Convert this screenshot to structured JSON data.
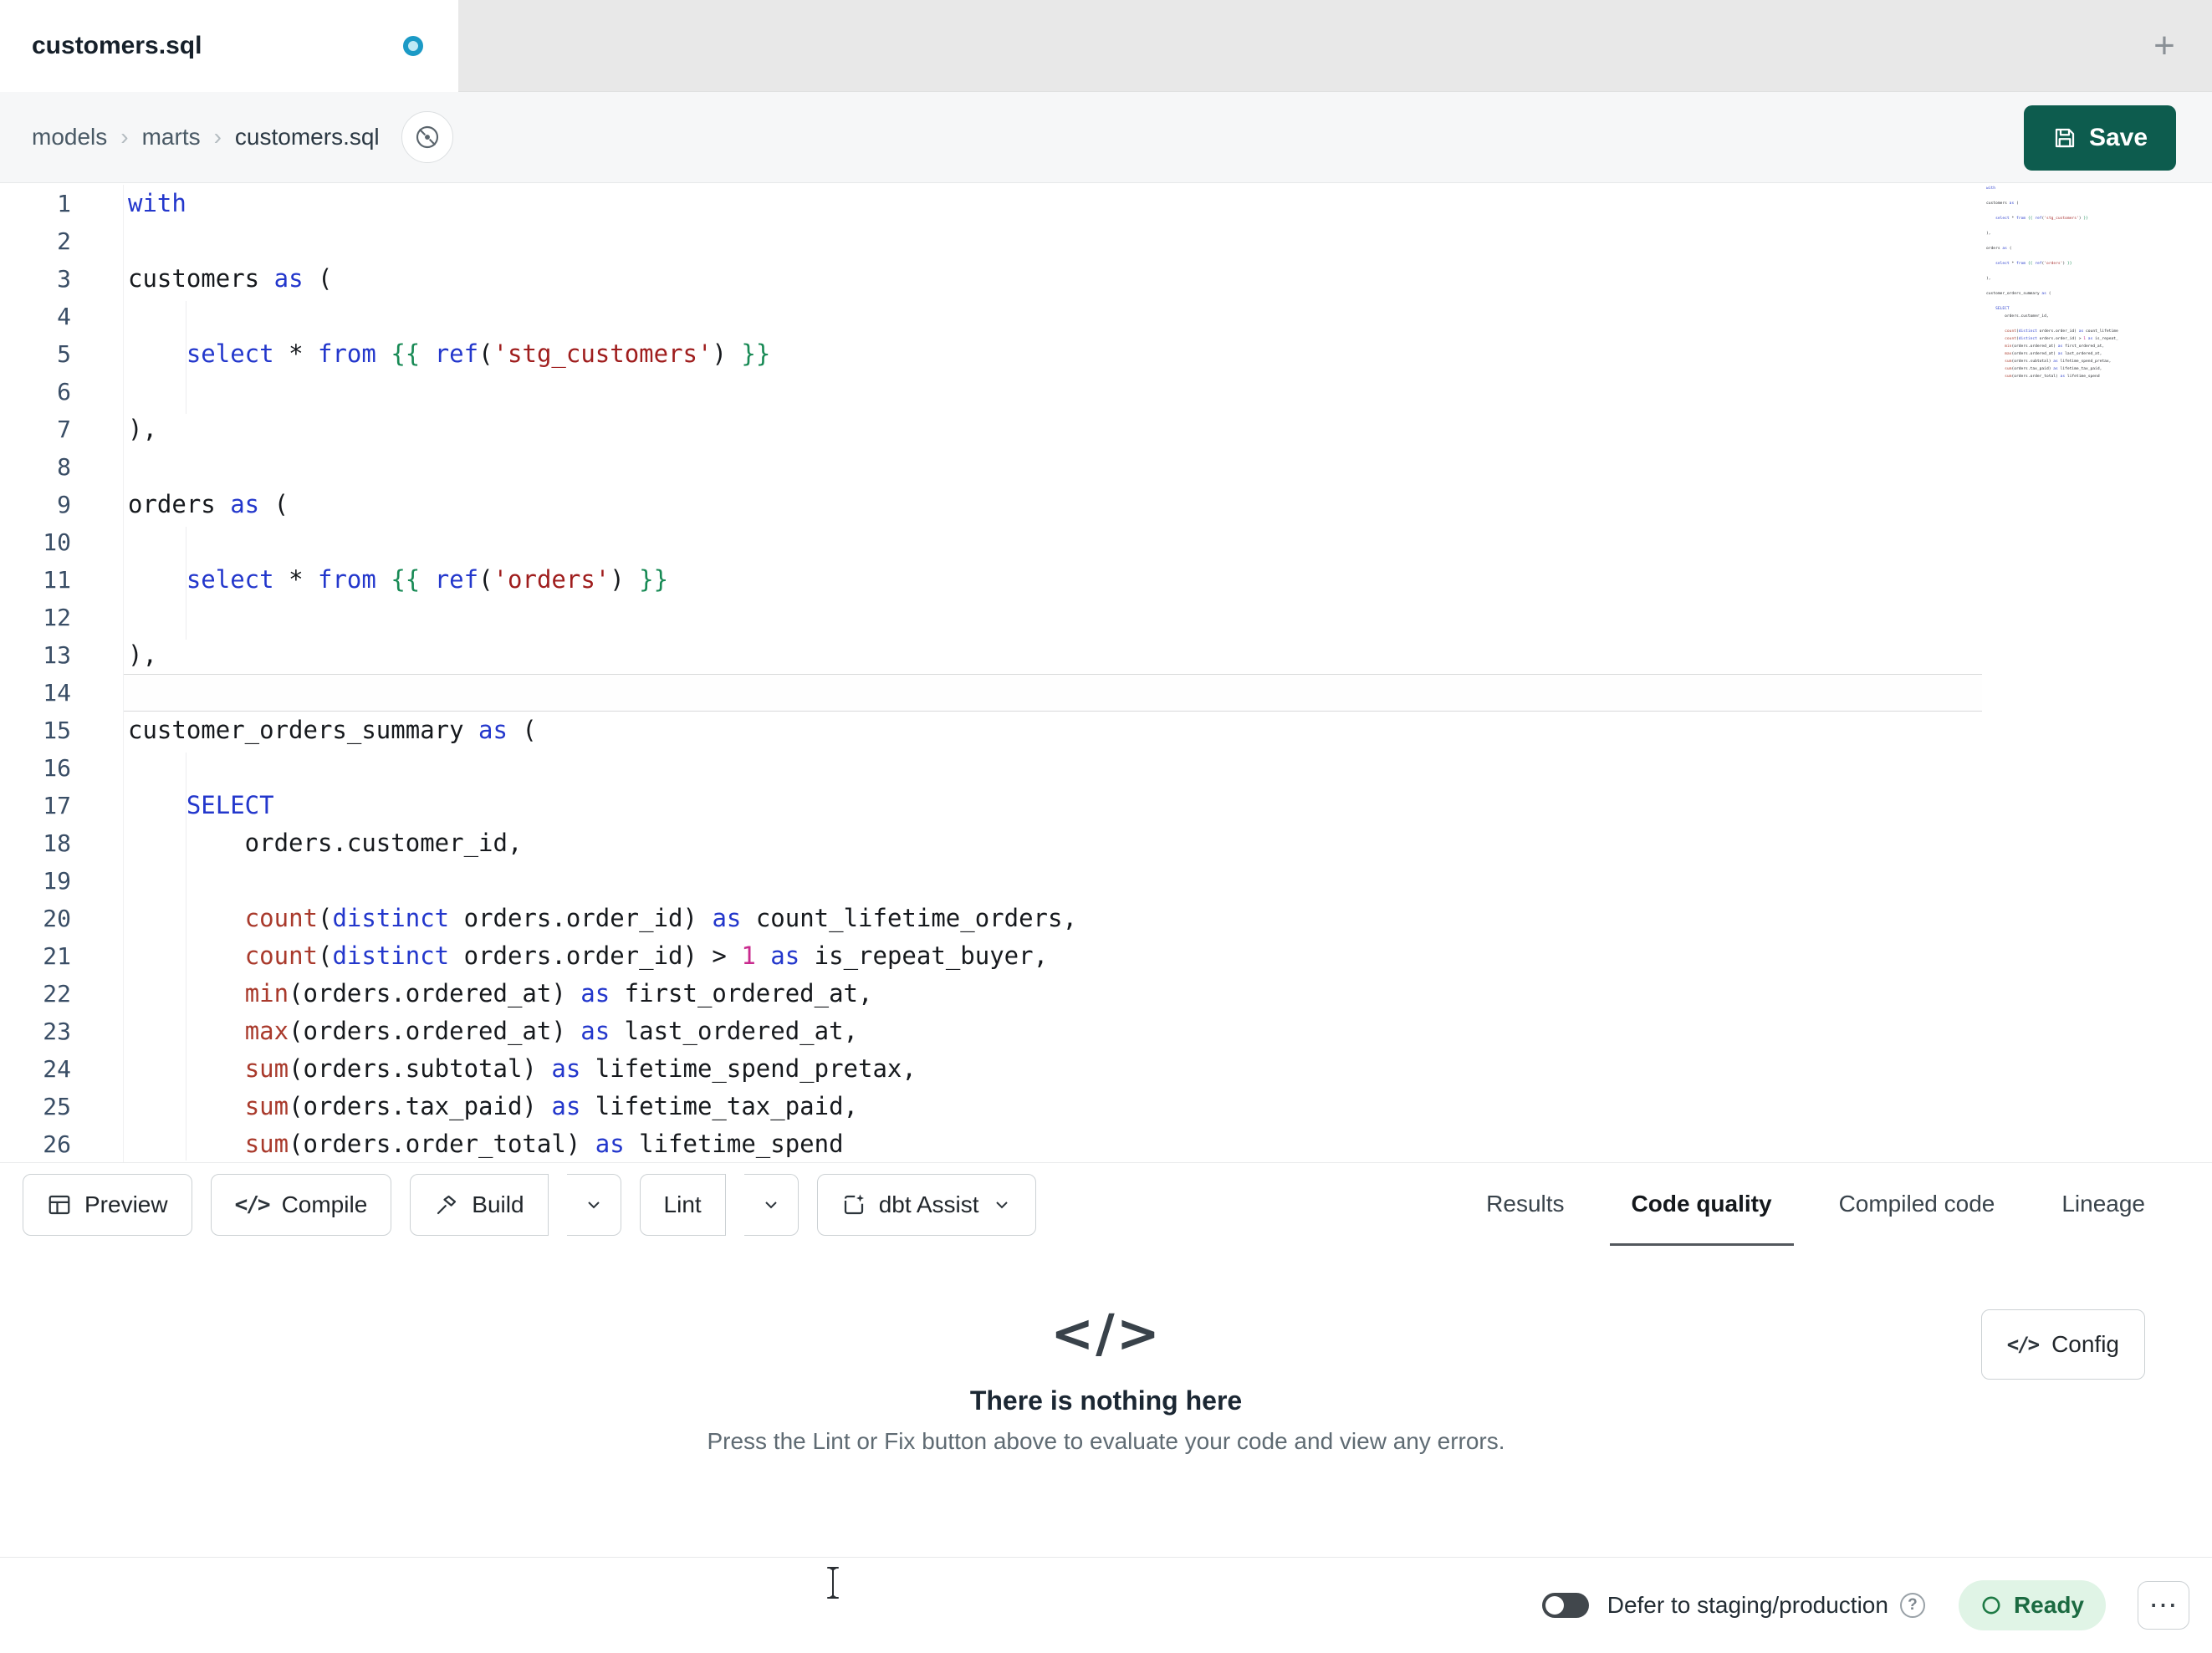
{
  "colors": {
    "save_button": "#0d5c4e",
    "keyword": "#2337cc",
    "function": "#a93a2c",
    "string": "#9f1d1d",
    "number": "#c92a8e",
    "jinja": "#188a55",
    "unsaved_dot": "#1b9ac6",
    "ready_bg": "#e0f4e6",
    "ready_text": "#1b6a41"
  },
  "icons": {
    "plus": "+",
    "overflow_dots": "⋯",
    "code_tag": "</>",
    "help": "?"
  },
  "tab_bar": {
    "title": "customers.sql",
    "unsaved": true
  },
  "breadcrumb": {
    "separator": "›",
    "items": [
      "models",
      "marts",
      "customers.sql"
    ]
  },
  "header": {
    "save_label": "Save"
  },
  "editor": {
    "current_line": 14,
    "lines": [
      {
        "n": 1,
        "tokens": [
          [
            "k",
            "with"
          ]
        ]
      },
      {
        "n": 2,
        "tokens": []
      },
      {
        "n": 3,
        "tokens": [
          [
            "p",
            "customers "
          ],
          [
            "k",
            "as"
          ],
          [
            "p",
            " ("
          ]
        ]
      },
      {
        "n": 4,
        "tokens": []
      },
      {
        "n": 5,
        "tokens": [
          [
            "p",
            "    "
          ],
          [
            "k",
            "select"
          ],
          [
            "p",
            " * "
          ],
          [
            "k",
            "from"
          ],
          [
            "p",
            " "
          ],
          [
            "j",
            "{{"
          ],
          [
            "p",
            " "
          ],
          [
            "k",
            "ref"
          ],
          [
            "p",
            "("
          ],
          [
            "s",
            "'stg_customers'"
          ],
          [
            "p",
            ") "
          ],
          [
            "j",
            "}}"
          ]
        ]
      },
      {
        "n": 6,
        "tokens": []
      },
      {
        "n": 7,
        "tokens": [
          [
            "p",
            "),"
          ]
        ]
      },
      {
        "n": 8,
        "tokens": []
      },
      {
        "n": 9,
        "tokens": [
          [
            "p",
            "orders "
          ],
          [
            "k",
            "as"
          ],
          [
            "p",
            " ("
          ]
        ]
      },
      {
        "n": 10,
        "tokens": []
      },
      {
        "n": 11,
        "tokens": [
          [
            "p",
            "    "
          ],
          [
            "k",
            "select"
          ],
          [
            "p",
            " * "
          ],
          [
            "k",
            "from"
          ],
          [
            "p",
            " "
          ],
          [
            "j",
            "{{"
          ],
          [
            "p",
            " "
          ],
          [
            "k",
            "ref"
          ],
          [
            "p",
            "("
          ],
          [
            "s",
            "'orders'"
          ],
          [
            "p",
            ") "
          ],
          [
            "j",
            "}}"
          ]
        ]
      },
      {
        "n": 12,
        "tokens": []
      },
      {
        "n": 13,
        "tokens": [
          [
            "p",
            "),"
          ]
        ]
      },
      {
        "n": 14,
        "tokens": []
      },
      {
        "n": 15,
        "tokens": [
          [
            "p",
            "customer_orders_summary "
          ],
          [
            "k",
            "as"
          ],
          [
            "p",
            " ("
          ]
        ]
      },
      {
        "n": 16,
        "tokens": []
      },
      {
        "n": 17,
        "tokens": [
          [
            "p",
            "    "
          ],
          [
            "k",
            "SELECT"
          ]
        ]
      },
      {
        "n": 18,
        "tokens": [
          [
            "p",
            "        orders.customer_id,"
          ]
        ]
      },
      {
        "n": 19,
        "tokens": []
      },
      {
        "n": 20,
        "tokens": [
          [
            "p",
            "        "
          ],
          [
            "f",
            "count"
          ],
          [
            "p",
            "("
          ],
          [
            "k",
            "distinct"
          ],
          [
            "p",
            " orders.order_id) "
          ],
          [
            "k",
            "as"
          ],
          [
            "p",
            " count_lifetime_orders,"
          ]
        ]
      },
      {
        "n": 21,
        "tokens": [
          [
            "p",
            "        "
          ],
          [
            "f",
            "count"
          ],
          [
            "p",
            "("
          ],
          [
            "k",
            "distinct"
          ],
          [
            "p",
            " orders.order_id) > "
          ],
          [
            "n",
            "1"
          ],
          [
            "p",
            " "
          ],
          [
            "k",
            "as"
          ],
          [
            "p",
            " is_repeat_buyer,"
          ]
        ]
      },
      {
        "n": 22,
        "tokens": [
          [
            "p",
            "        "
          ],
          [
            "f",
            "min"
          ],
          [
            "p",
            "(orders.ordered_at) "
          ],
          [
            "k",
            "as"
          ],
          [
            "p",
            " first_ordered_at,"
          ]
        ]
      },
      {
        "n": 23,
        "tokens": [
          [
            "p",
            "        "
          ],
          [
            "f",
            "max"
          ],
          [
            "p",
            "(orders.ordered_at) "
          ],
          [
            "k",
            "as"
          ],
          [
            "p",
            " last_ordered_at,"
          ]
        ]
      },
      {
        "n": 24,
        "tokens": [
          [
            "p",
            "        "
          ],
          [
            "f",
            "sum"
          ],
          [
            "p",
            "(orders.subtotal) "
          ],
          [
            "k",
            "as"
          ],
          [
            "p",
            " lifetime_spend_pretax,"
          ]
        ]
      },
      {
        "n": 25,
        "tokens": [
          [
            "p",
            "        "
          ],
          [
            "f",
            "sum"
          ],
          [
            "p",
            "(orders.tax_paid) "
          ],
          [
            "k",
            "as"
          ],
          [
            "p",
            " lifetime_tax_paid,"
          ]
        ]
      },
      {
        "n": 26,
        "tokens": [
          [
            "p",
            "        "
          ],
          [
            "f",
            "sum"
          ],
          [
            "p",
            "(orders.order_total) "
          ],
          [
            "k",
            "as"
          ],
          [
            "p",
            " lifetime_spend"
          ]
        ]
      }
    ]
  },
  "toolbar": {
    "buttons": [
      {
        "label": "Preview",
        "icon": "table-icon"
      },
      {
        "label": "Compile",
        "icon": "code-icon"
      },
      {
        "label": "Build",
        "icon": "hammer-icon",
        "has_dropdown": true
      },
      {
        "label": "Lint",
        "has_dropdown": true
      },
      {
        "label": "dbt Assist",
        "icon": "assist-sparkle-icon",
        "has_dropdown": true
      }
    ],
    "tabs": [
      {
        "label": "Results",
        "active": false
      },
      {
        "label": "Code quality",
        "active": true
      },
      {
        "label": "Compiled code",
        "active": false
      },
      {
        "label": "Lineage",
        "active": false
      }
    ]
  },
  "empty_state": {
    "title": "There is nothing here",
    "subtitle": "Press the Lint or Fix button above to evaluate your code and view any errors.",
    "config_label": "Config"
  },
  "status_bar": {
    "defer_label": "Defer to staging/production",
    "ready_label": "Ready"
  }
}
